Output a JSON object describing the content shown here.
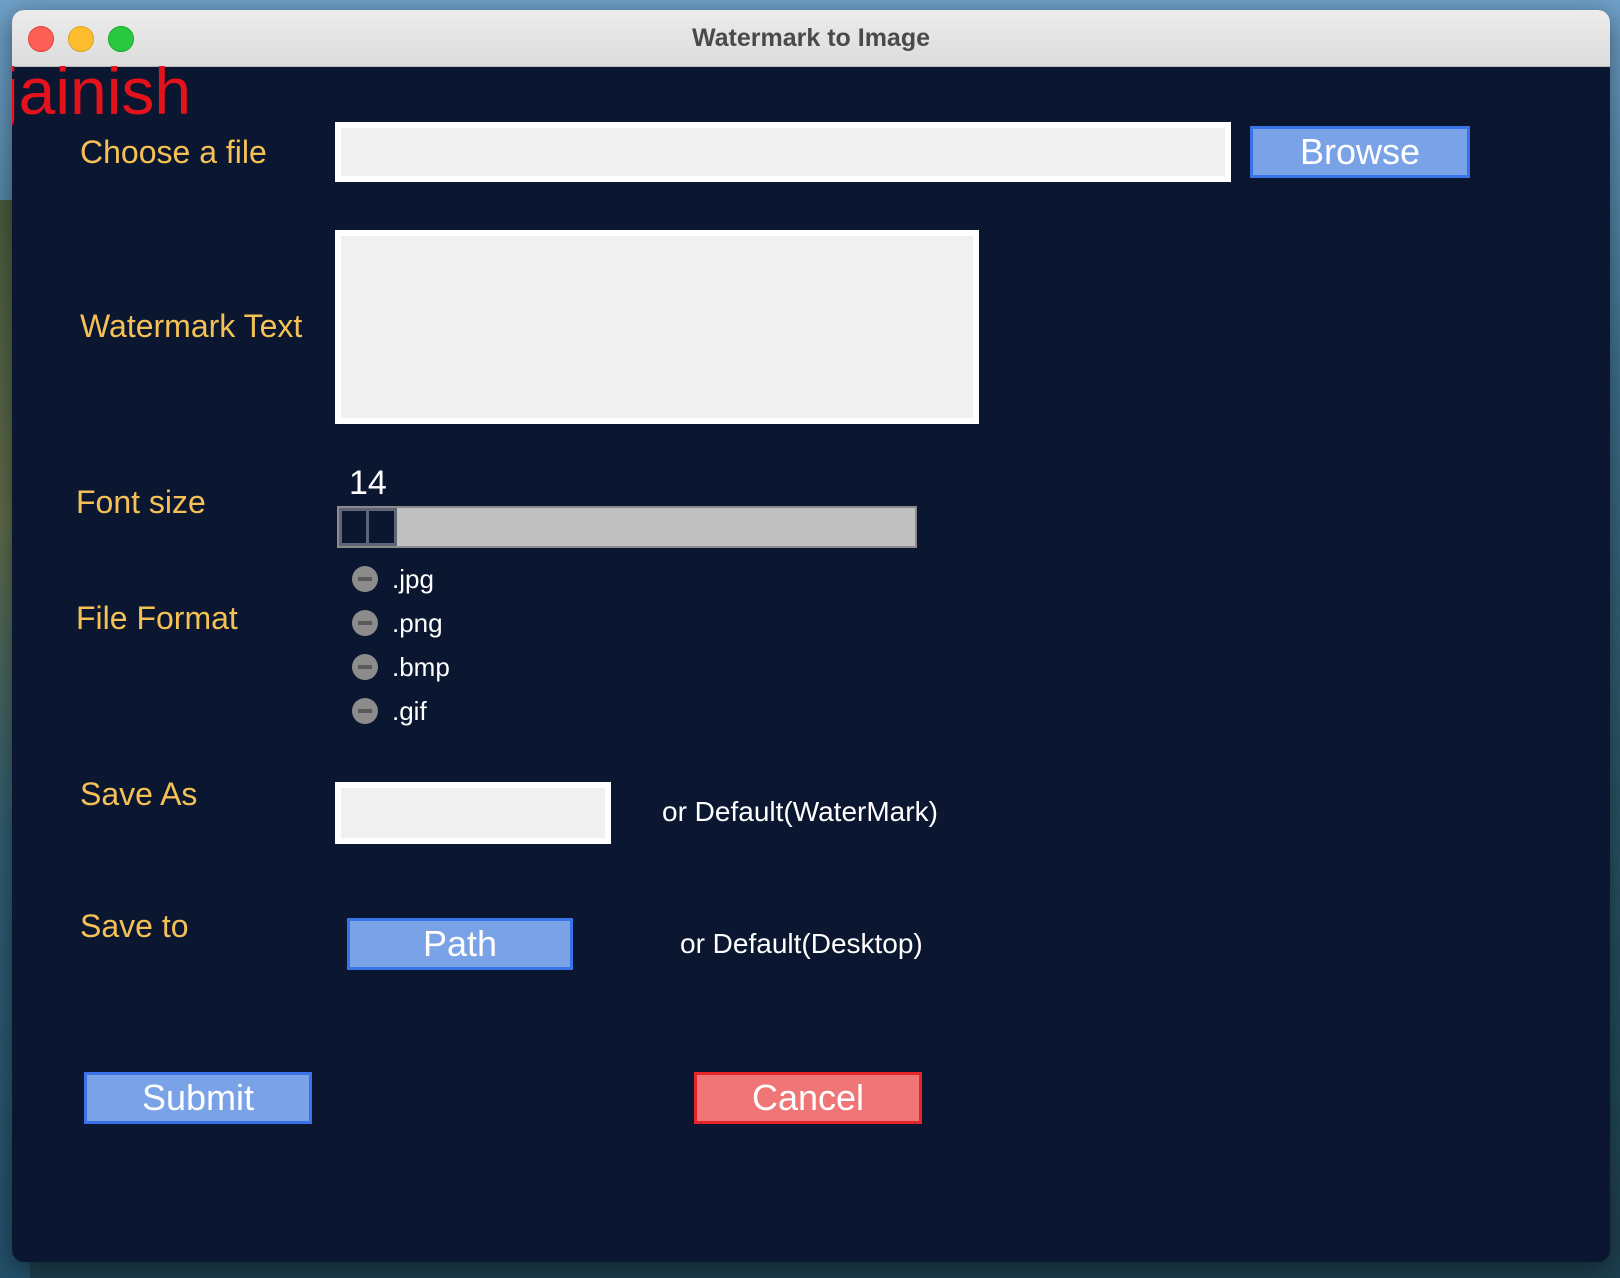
{
  "window": {
    "title": "Watermark to Image"
  },
  "author": "jainish",
  "file": {
    "label": "Choose a file",
    "value": "",
    "browse_label": "Browse"
  },
  "watermark": {
    "label": "Watermark Text",
    "value": ""
  },
  "font_size": {
    "label": "Font size",
    "value": "14"
  },
  "file_format": {
    "label": "File Format",
    "options": [
      ".jpg",
      ".png",
      ".bmp",
      ".gif"
    ]
  },
  "save_as": {
    "label": "Save As",
    "value": "",
    "default_note": "or Default(WaterMark)"
  },
  "save_to": {
    "label": "Save to",
    "path_label": "Path",
    "default_note": "or Default(Desktop)"
  },
  "actions": {
    "submit_label": "Submit",
    "cancel_label": "Cancel"
  },
  "colors": {
    "background": "#0b1730",
    "label": "#f5c155",
    "button_blue": "#7aa2e6",
    "button_red": "#f07577",
    "author": "#e5121b"
  }
}
